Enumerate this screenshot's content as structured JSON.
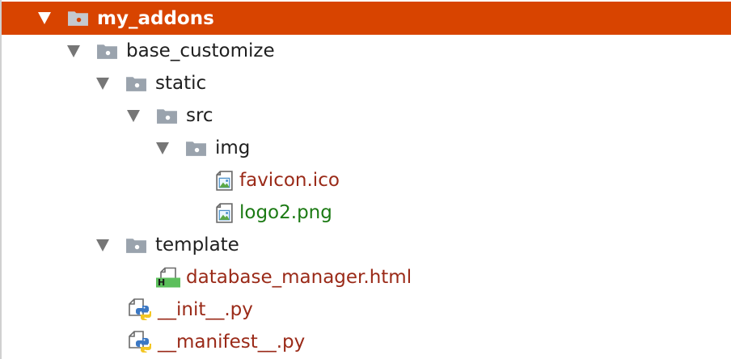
{
  "tree": {
    "root": {
      "label": "my_addons"
    },
    "base_customize": {
      "label": "base_customize"
    },
    "static": {
      "label": "static"
    },
    "src": {
      "label": "src"
    },
    "img": {
      "label": "img"
    },
    "favicon": {
      "label": "favicon.ico"
    },
    "logo2": {
      "label": "logo2.png"
    },
    "template": {
      "label": "template"
    },
    "database_manager": {
      "label": "database_manager.html",
      "badge": "H"
    },
    "init": {
      "label": "__init__.py"
    },
    "manifest": {
      "label": "__manifest__.py"
    }
  },
  "colors": {
    "selection": "#d84400",
    "folder": "#9aa3ad",
    "modified_file": "#9a2a18",
    "added_file": "#1c7a14",
    "html_badge": "#5cbf5c"
  }
}
